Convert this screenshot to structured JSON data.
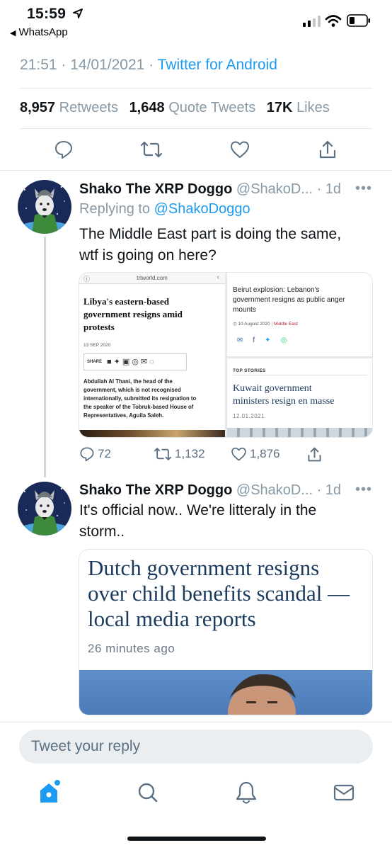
{
  "status_bar": {
    "time": "15:59",
    "back_app": "WhatsApp"
  },
  "tweet_meta": {
    "time": "21:51",
    "date": "14/01/2021",
    "source": "Twitter for Android"
  },
  "stats": {
    "retweets_count": "8,957",
    "retweets_label": "Retweets",
    "quotes_count": "1,648",
    "quotes_label": "Quote Tweets",
    "likes_count": "17K",
    "likes_label": "Likes"
  },
  "reply1": {
    "name": "Shako The XRP Doggo",
    "handle": "@ShakoD...",
    "age": "· 1d",
    "more": "•••",
    "replying_prefix": "Replying to",
    "replying_handle": "@ShakoDoggo",
    "text_line1": "The Middle East part is doing the same,",
    "text_line2": "wtf is going on here?",
    "replies": "72",
    "retweets": "1,132",
    "likes": "1,876",
    "images": {
      "left": {
        "site": "trtworld.com",
        "headline_l1": "Libya's eastern-based",
        "headline_l2": "government resigns amid",
        "headline_l3": "protests",
        "date": "13 SEP 2020",
        "share": "SHARE",
        "body_l1": "Abdullah Al Thani, the head of the",
        "body_l2": "government, which is not recognised",
        "body_l3": "internationally, submitted its resignation to",
        "body_l4": "the speaker of the Tobruk-based House of",
        "body_l5": "Representatives, Aguila Saleh."
      },
      "top_right": {
        "headline_l1": "Beirut explosion: Lebanon's",
        "headline_l2": "government resigns as public anger",
        "headline_l3": "mounts",
        "date": "10 August 2020",
        "section": "Middle East"
      },
      "bottom_right": {
        "label": "TOP STORIES",
        "headline_l1": "Kuwait government",
        "headline_l2": "ministers resign en masse",
        "date": "12.01.2021"
      }
    }
  },
  "reply2": {
    "name": "Shako The XRP Doggo",
    "handle": "@ShakoD...",
    "age": "· 1d",
    "more": "•••",
    "text_line1": "It's official now.. We're litteraly in the",
    "text_line2": "storm..",
    "card": {
      "title_l1": "Dutch government resigns",
      "title_l2": "over child benefits scandal —",
      "title_l3": "local media reports",
      "age": "26 minutes ago"
    }
  },
  "reply_input": {
    "placeholder": "Tweet your reply"
  },
  "colors": {
    "accent": "#1d9bf0",
    "muted": "#8899a6",
    "divider": "#e1e8ed"
  }
}
